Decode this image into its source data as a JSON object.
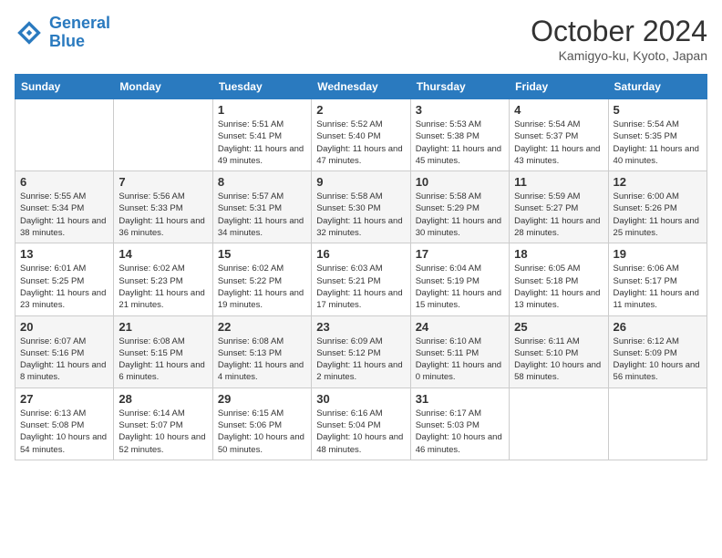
{
  "header": {
    "logo_line1": "General",
    "logo_line2": "Blue",
    "month_title": "October 2024",
    "location": "Kamigyo-ku, Kyoto, Japan"
  },
  "days_of_week": [
    "Sunday",
    "Monday",
    "Tuesday",
    "Wednesday",
    "Thursday",
    "Friday",
    "Saturday"
  ],
  "weeks": [
    [
      {
        "day": "",
        "info": ""
      },
      {
        "day": "",
        "info": ""
      },
      {
        "day": "1",
        "info": "Sunrise: 5:51 AM\nSunset: 5:41 PM\nDaylight: 11 hours and 49 minutes."
      },
      {
        "day": "2",
        "info": "Sunrise: 5:52 AM\nSunset: 5:40 PM\nDaylight: 11 hours and 47 minutes."
      },
      {
        "day": "3",
        "info": "Sunrise: 5:53 AM\nSunset: 5:38 PM\nDaylight: 11 hours and 45 minutes."
      },
      {
        "day": "4",
        "info": "Sunrise: 5:54 AM\nSunset: 5:37 PM\nDaylight: 11 hours and 43 minutes."
      },
      {
        "day": "5",
        "info": "Sunrise: 5:54 AM\nSunset: 5:35 PM\nDaylight: 11 hours and 40 minutes."
      }
    ],
    [
      {
        "day": "6",
        "info": "Sunrise: 5:55 AM\nSunset: 5:34 PM\nDaylight: 11 hours and 38 minutes."
      },
      {
        "day": "7",
        "info": "Sunrise: 5:56 AM\nSunset: 5:33 PM\nDaylight: 11 hours and 36 minutes."
      },
      {
        "day": "8",
        "info": "Sunrise: 5:57 AM\nSunset: 5:31 PM\nDaylight: 11 hours and 34 minutes."
      },
      {
        "day": "9",
        "info": "Sunrise: 5:58 AM\nSunset: 5:30 PM\nDaylight: 11 hours and 32 minutes."
      },
      {
        "day": "10",
        "info": "Sunrise: 5:58 AM\nSunset: 5:29 PM\nDaylight: 11 hours and 30 minutes."
      },
      {
        "day": "11",
        "info": "Sunrise: 5:59 AM\nSunset: 5:27 PM\nDaylight: 11 hours and 28 minutes."
      },
      {
        "day": "12",
        "info": "Sunrise: 6:00 AM\nSunset: 5:26 PM\nDaylight: 11 hours and 25 minutes."
      }
    ],
    [
      {
        "day": "13",
        "info": "Sunrise: 6:01 AM\nSunset: 5:25 PM\nDaylight: 11 hours and 23 minutes."
      },
      {
        "day": "14",
        "info": "Sunrise: 6:02 AM\nSunset: 5:23 PM\nDaylight: 11 hours and 21 minutes."
      },
      {
        "day": "15",
        "info": "Sunrise: 6:02 AM\nSunset: 5:22 PM\nDaylight: 11 hours and 19 minutes."
      },
      {
        "day": "16",
        "info": "Sunrise: 6:03 AM\nSunset: 5:21 PM\nDaylight: 11 hours and 17 minutes."
      },
      {
        "day": "17",
        "info": "Sunrise: 6:04 AM\nSunset: 5:19 PM\nDaylight: 11 hours and 15 minutes."
      },
      {
        "day": "18",
        "info": "Sunrise: 6:05 AM\nSunset: 5:18 PM\nDaylight: 11 hours and 13 minutes."
      },
      {
        "day": "19",
        "info": "Sunrise: 6:06 AM\nSunset: 5:17 PM\nDaylight: 11 hours and 11 minutes."
      }
    ],
    [
      {
        "day": "20",
        "info": "Sunrise: 6:07 AM\nSunset: 5:16 PM\nDaylight: 11 hours and 8 minutes."
      },
      {
        "day": "21",
        "info": "Sunrise: 6:08 AM\nSunset: 5:15 PM\nDaylight: 11 hours and 6 minutes."
      },
      {
        "day": "22",
        "info": "Sunrise: 6:08 AM\nSunset: 5:13 PM\nDaylight: 11 hours and 4 minutes."
      },
      {
        "day": "23",
        "info": "Sunrise: 6:09 AM\nSunset: 5:12 PM\nDaylight: 11 hours and 2 minutes."
      },
      {
        "day": "24",
        "info": "Sunrise: 6:10 AM\nSunset: 5:11 PM\nDaylight: 11 hours and 0 minutes."
      },
      {
        "day": "25",
        "info": "Sunrise: 6:11 AM\nSunset: 5:10 PM\nDaylight: 10 hours and 58 minutes."
      },
      {
        "day": "26",
        "info": "Sunrise: 6:12 AM\nSunset: 5:09 PM\nDaylight: 10 hours and 56 minutes."
      }
    ],
    [
      {
        "day": "27",
        "info": "Sunrise: 6:13 AM\nSunset: 5:08 PM\nDaylight: 10 hours and 54 minutes."
      },
      {
        "day": "28",
        "info": "Sunrise: 6:14 AM\nSunset: 5:07 PM\nDaylight: 10 hours and 52 minutes."
      },
      {
        "day": "29",
        "info": "Sunrise: 6:15 AM\nSunset: 5:06 PM\nDaylight: 10 hours and 50 minutes."
      },
      {
        "day": "30",
        "info": "Sunrise: 6:16 AM\nSunset: 5:04 PM\nDaylight: 10 hours and 48 minutes."
      },
      {
        "day": "31",
        "info": "Sunrise: 6:17 AM\nSunset: 5:03 PM\nDaylight: 10 hours and 46 minutes."
      },
      {
        "day": "",
        "info": ""
      },
      {
        "day": "",
        "info": ""
      }
    ]
  ]
}
